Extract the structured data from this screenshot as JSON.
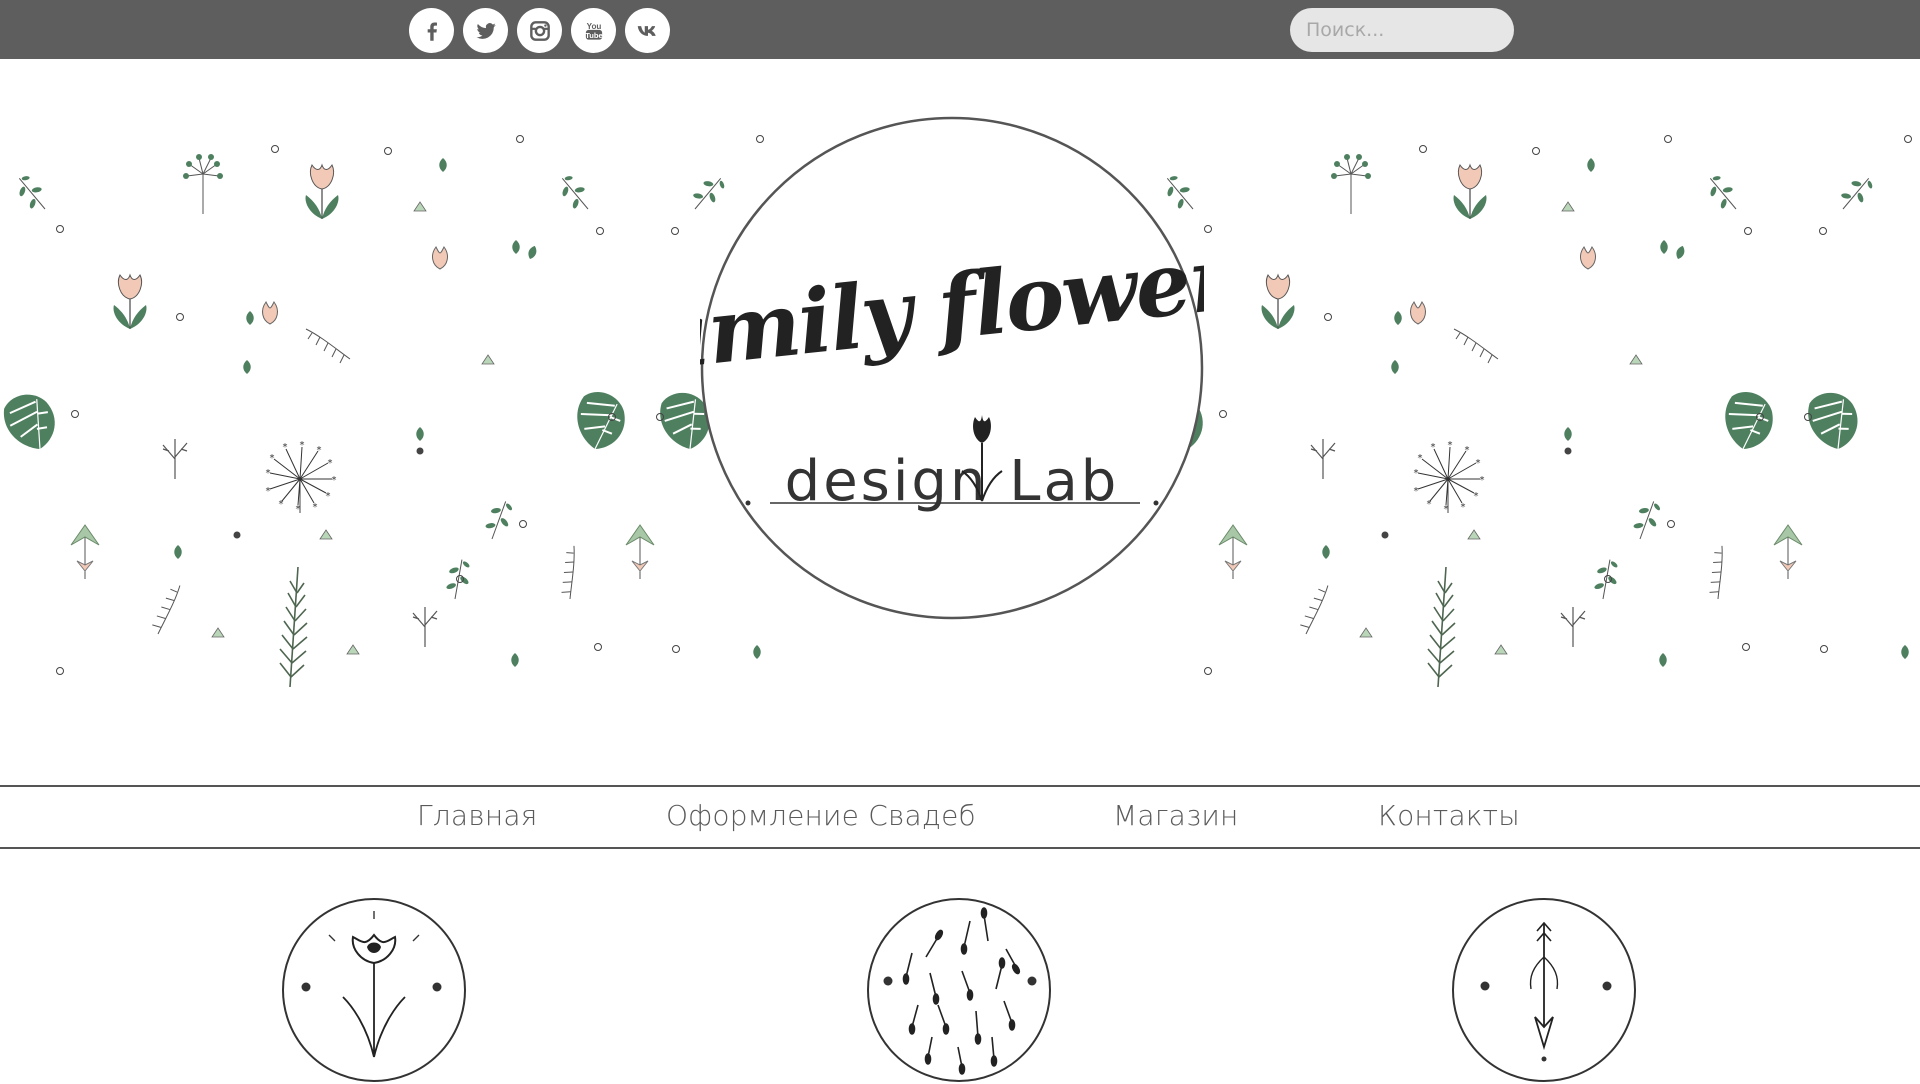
{
  "social": [
    {
      "name": "facebook-icon",
      "glyph": "f"
    },
    {
      "name": "twitter-icon",
      "glyph": "bird"
    },
    {
      "name": "instagram-icon",
      "glyph": "camera"
    },
    {
      "name": "youtube-icon",
      "glyph": "You Tube"
    },
    {
      "name": "vk-icon",
      "glyph": "vk"
    }
  ],
  "search": {
    "placeholder": "Поиск..."
  },
  "logo": {
    "line1": "family flowers",
    "line2": "design Lab",
    "image_semantic": "tulip-icon"
  },
  "nav": {
    "home": "Главная",
    "weddings": "Оформление Свадеб",
    "shop": "Магазин",
    "contacts": "Контакты"
  },
  "features": [
    {
      "icon": "flower-bud-icon"
    },
    {
      "icon": "seeds-icon"
    },
    {
      "icon": "arrow-sprout-icon"
    }
  ],
  "colors": {
    "topbar": "#5e5e5e",
    "leaf_green": "#4e8060",
    "petal_pink": "#f2c9b6",
    "ink": "#333333"
  }
}
